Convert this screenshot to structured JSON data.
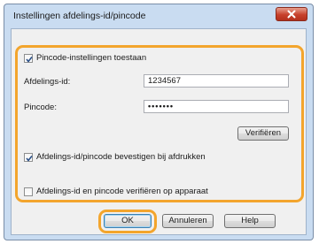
{
  "window": {
    "title": "Instellingen afdelings-id/pincode",
    "close_icon": "close-icon"
  },
  "settings": {
    "enable_pin_label": "Pincode-instellingen toestaan",
    "enable_pin_checked": true,
    "department_id_label": "Afdelings-id:",
    "department_id_value": "1234567",
    "pin_label": "Pincode:",
    "pin_value": "•••••••",
    "verify_button": "Verifiëren",
    "confirm_print_label": "Afdelings-id/pincode bevestigen bij afdrukken",
    "confirm_print_checked": true,
    "verify_device_label": "Afdelings-id en pincode verifiëren op apparaat",
    "verify_device_checked": false
  },
  "footer": {
    "ok_label": "OK",
    "cancel_label": "Annuleren",
    "help_label": "Help"
  },
  "colors": {
    "highlight": "#f3a52d",
    "window_frame": "#c9dcf1",
    "close_button": "#c7402b"
  }
}
